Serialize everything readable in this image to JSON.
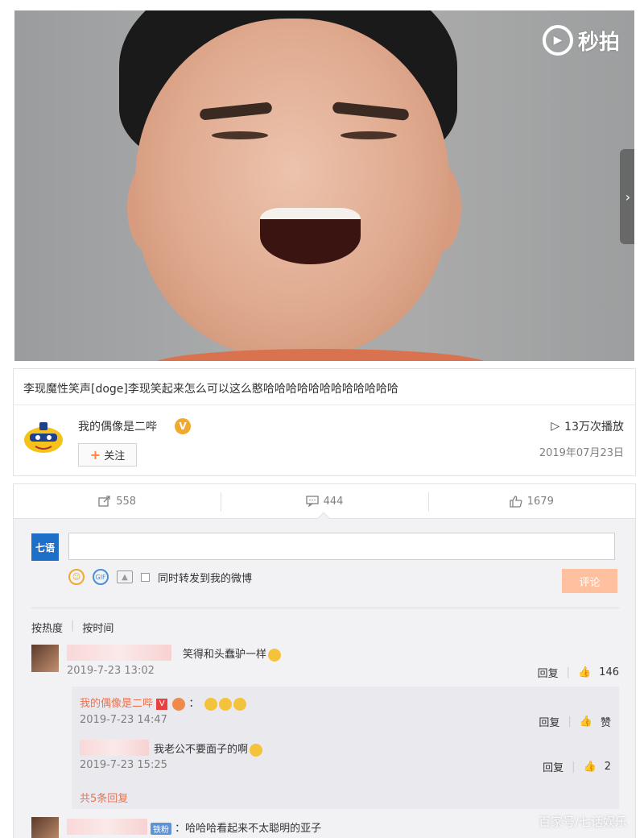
{
  "video": {
    "logo_text": "秒拍",
    "next_arrow": "›"
  },
  "post": {
    "caption": "李现魔性笑声[doge]李现笑起来怎么可以这么憨哈哈哈哈哈哈哈哈哈哈哈哈",
    "author": "我的偶像是二哔",
    "verified_badge": "V",
    "follow_label": "关注",
    "follow_plus": "+",
    "plays_icon": "▷",
    "plays": "13万次播放",
    "date": "2019年07月23日"
  },
  "actions": {
    "repost_count": "558",
    "comment_count": "444",
    "like_count": "1679"
  },
  "composer": {
    "avatar_text": "七语",
    "also_repost_label": "同时转发到我的微博",
    "submit_label": "评论",
    "gif_label": "GIF"
  },
  "sort": {
    "by_hot": "按热度",
    "by_time": "按时间"
  },
  "comments": [
    {
      "text": "笑得和头蠢驴一样",
      "time": "2019-7-23 13:02",
      "reply_label": "回复",
      "likes": "146"
    }
  ],
  "replies": [
    {
      "name": "我的偶像是二哔",
      "badge": "V",
      "text": "：",
      "time": "2019-7-23 14:47",
      "reply_label": "回复",
      "likes": "赞"
    },
    {
      "text": "我老公不要面子的啊",
      "time": "2019-7-23 15:25",
      "reply_label": "回复",
      "likes": "2"
    }
  ],
  "more_replies": "共5条回复",
  "last_comment": {
    "badge": "铁粉",
    "text": "：哈哈哈看起来不太聪明的亚子"
  },
  "watermark": "百家号/七话娱乐"
}
